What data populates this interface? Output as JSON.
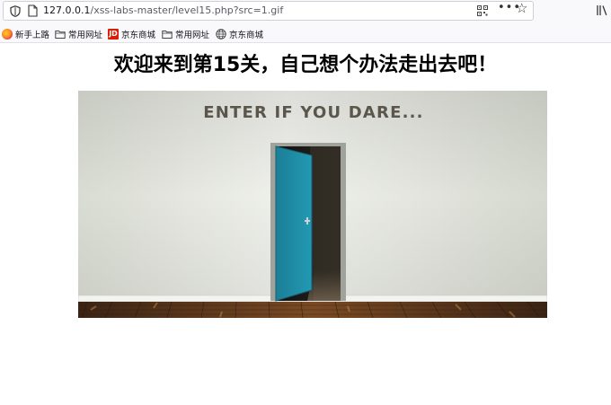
{
  "browser": {
    "url_host": "127.0.0.1",
    "url_path": "/xss-labs-master/level15.php?src=1.gif",
    "menu_dots": "•••",
    "bookmark_star": "☆"
  },
  "bookmarks": [
    {
      "label": "新手上路",
      "icon": "firefox-icon"
    },
    {
      "label": "常用网址",
      "icon": "folder-icon"
    },
    {
      "label": "京东商城",
      "icon": "jd-icon"
    },
    {
      "label": "常用网址",
      "icon": "folder-icon"
    },
    {
      "label": "京东商城",
      "icon": "globe-icon"
    }
  ],
  "page": {
    "heading": "欢迎来到第15关，自己想个办法走出去吧！",
    "image_caption": "ENTER IF YOU DARE..."
  },
  "colors": {
    "door": "#1f8ea6",
    "wall": "#e9ebe4",
    "floor": "#6b3f1f"
  }
}
